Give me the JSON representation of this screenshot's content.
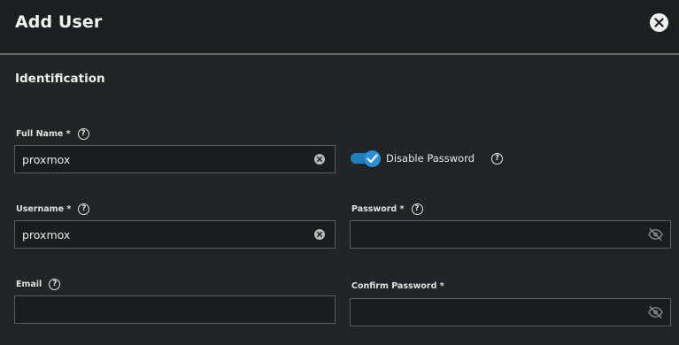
{
  "dialog": {
    "title": "Add User",
    "close_icon": "close-icon"
  },
  "section": {
    "title": "Identification"
  },
  "fields": {
    "full_name": {
      "label": "Full Name *",
      "value": "proxmox",
      "help_icon": "help-icon",
      "clear_icon": "clear-icon"
    },
    "username": {
      "label": "Username *",
      "value": "proxmox",
      "help_icon": "help-icon",
      "clear_icon": "clear-icon"
    },
    "email": {
      "label": "Email",
      "value": "",
      "help_icon": "help-icon"
    },
    "disable_password": {
      "label": "Disable Password",
      "checked": true,
      "accent": "#1f7fbf",
      "help_icon": "help-icon"
    },
    "password": {
      "label": "Password *",
      "value": "",
      "help_icon": "help-icon",
      "visibility_icon": "eye-off-icon"
    },
    "confirm_password": {
      "label": "Confirm Password *",
      "value": "",
      "visibility_icon": "eye-off-icon"
    }
  },
  "help_glyph": "?"
}
